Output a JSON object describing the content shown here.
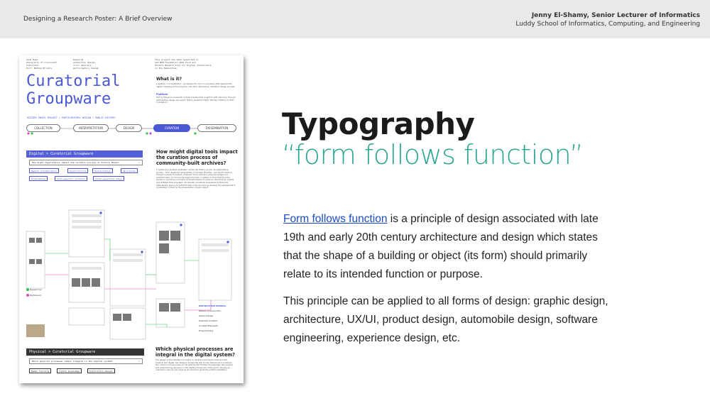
{
  "header": {
    "left_title": "Designing a Research Poster: A Brief Overview",
    "author": "Jenny El-Shamy, Senior Lecturer of Informatics",
    "school": "Luddy School of Informatics, Computing, and Engineering"
  },
  "slide": {
    "title": "Typography",
    "subtitle": "“form follows function”",
    "paragraph1_link": "Form follows function",
    "paragraph1_rest": " is a principle of design associated with late 19th and early 20th century architecture and design which states that the shape of a building or object (its form) should primarily relate to its intended function or purpose.",
    "paragraph2": "This principle can be applied to all forms of design: graphic design, architecture, UX/UI, product design, automobile design, software engineering, experience design, etc."
  },
  "poster": {
    "meta_col1": "Anna Hoes\nUniversity of Cincinnati\nInstructor\nProf. Bethoe Brinkly",
    "meta_col2": "Keywords\nexhibition design,\ncivic advocacy,\nparticipatory design",
    "meta_col3": "This project has been supported in\nand NEH Foundation 2021 Fund and\nHolokit Benefit Fund for Digital Scholarship\nin the Humanities",
    "title_line1": "Curatorial",
    "title_line2": "Groupware",
    "subtitle": "HISTORY MOVES PROJECT | PARTICIPATORY DESIGN • PUBLIC HISTORY",
    "what_heading": "What is it?",
    "what_body": "A system – not exhibitions – groupware for civic or volunteers that expands the digital mediating of the physical, and other dimensions: exhibition design process.",
    "platform_heading": "Platform",
    "platform_body": "History Moves is a research cultural practice that sought to shift advocacy through participatory design of a public history exhibition titled \"Women's History of 2017 in America\".",
    "steps": [
      "COLLECTION",
      "INTERPRETATION",
      "DESIGN",
      "CURATION",
      "DISSEMINATION"
    ],
    "active_step": "CURATION",
    "digital_bar": "Digital > Curatorial Groupware",
    "digital_question": "How might digitization impact the curation process of History Moves?",
    "digital_chips": [
      "Remote collaboration",
      "Synchronicity",
      "Visualization",
      "AR preview",
      "Programming",
      "Site-specific curation",
      "Touch-sensitive audio"
    ],
    "q1_heading": "How might digital tools impact the curation process of community-built archives?",
    "q1_body": "A mobile and modular exhibition carries the history of over 40 participating women – from dispersed geographies of Chicago, Brooklyn, and South Carolina – through a series of posters composed of the women's personal images and transformation of community-based archives. A system of tools that give the women's memories a moment of transformation to allow an idea through objects and artifacts from long-term documents. Curatorial Groupware furthers the participants' agency to self-articulate in the process by allowing the participants to curate their content in the presentation of each object.",
    "legend_researcher": "Researcher",
    "legend_participant": "Participant",
    "instruction_title": "INSTRUCTION MANUAL",
    "instruction_items": [
      "Mission & Instruction",
      "Space Design",
      "Selected Content",
      "Curated Elements",
      "Programming"
    ],
    "physical_bar": "Physical > Curatorial Groupware",
    "physical_question": "Which physical processes remain integral in the digital system?",
    "physical_chips": [
      "Human touching",
      "Locale knowledge",
      "Instruction manual"
    ],
    "q2_heading": "Which physical processes are integral in the digital system?",
    "q2_body": "The design of the exhibition is reliant on several mechanisms that are both physical and digital; the designer scopes the site for key themes and conditions; the curation process relies on the participants' firsthand knowledge; the curation and programming decisions in the digital process are combined to develop an instruction manual and physical document to guide the exhibit installation.",
    "colors": {
      "accent_blue": "#4a58d6",
      "participant": "#d94fbd",
      "researcher": "#35c44a",
      "dark_bar": "#333333",
      "digital_bar": "#5560d8"
    }
  }
}
